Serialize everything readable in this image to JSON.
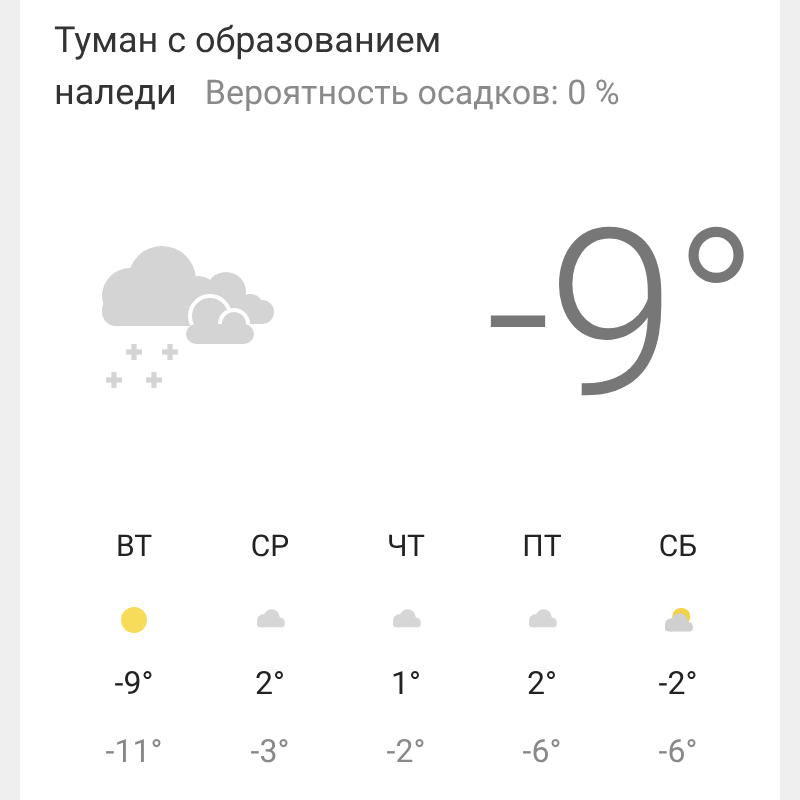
{
  "condition": "Туман с образованием",
  "condition_cont": "наледи",
  "precipitation": "Вероятность осадков: 0 %",
  "current": {
    "temperature": "-9°"
  },
  "forecast": [
    {
      "day": "ВТ",
      "kind": "sun",
      "high": "-9°",
      "low": "-11°"
    },
    {
      "day": "СР",
      "kind": "cloudy",
      "high": "2°",
      "low": "-3°"
    },
    {
      "day": "ЧТ",
      "kind": "cloudy",
      "high": "1°",
      "low": "-2°"
    },
    {
      "day": "ПТ",
      "kind": "cloudy",
      "high": "2°",
      "low": "-6°"
    },
    {
      "day": "СБ",
      "kind": "partly-cloudy",
      "high": "-2°",
      "low": "-6°"
    }
  ]
}
